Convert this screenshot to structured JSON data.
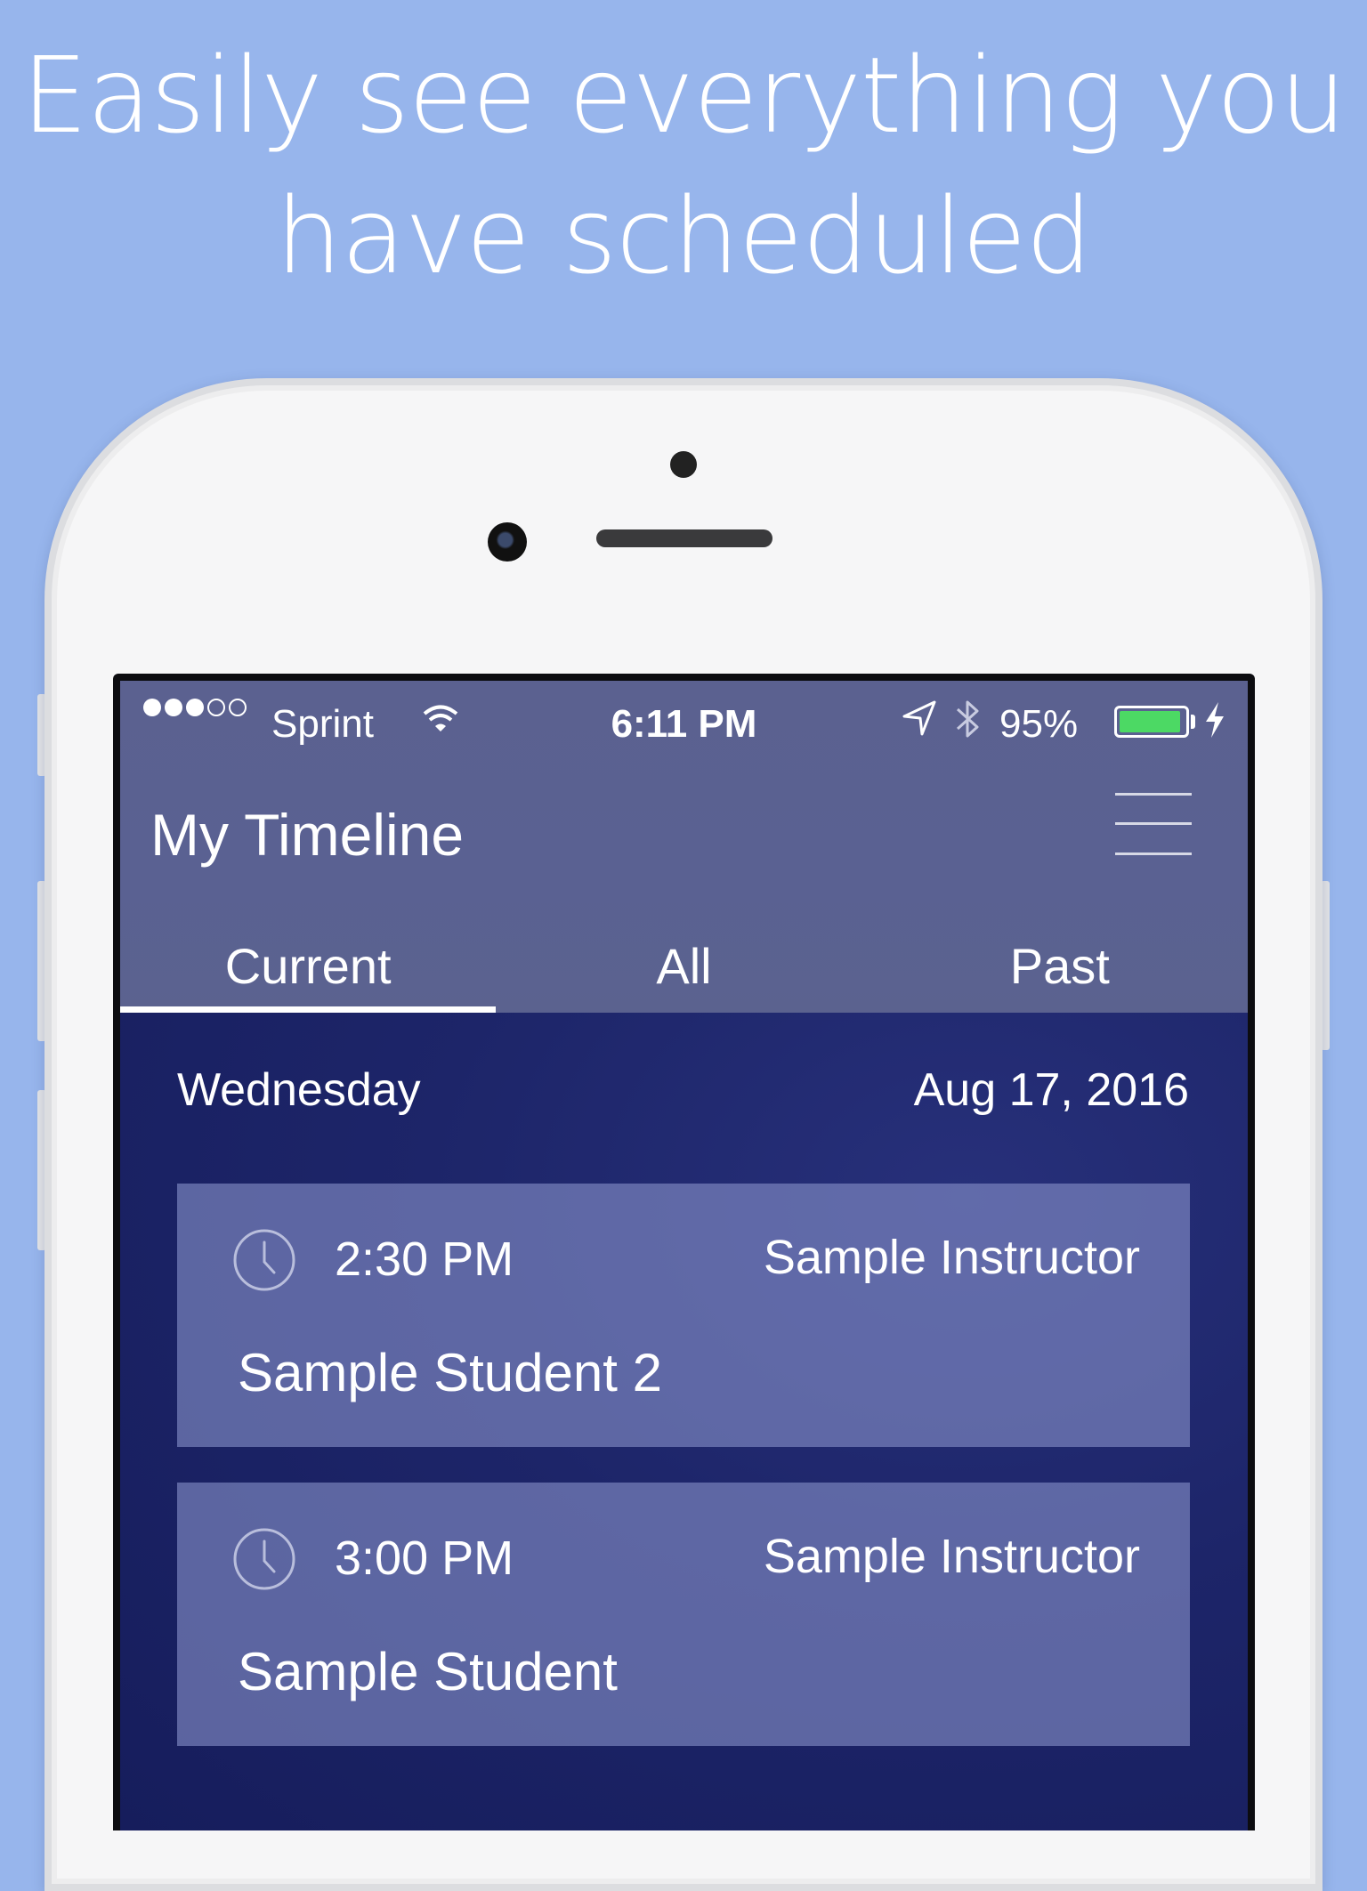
{
  "headline": {
    "line1": "Easily see everything you",
    "line2": "have scheduled"
  },
  "status_bar": {
    "signal_dots": "●●●○○",
    "carrier": "Sprint",
    "time": "6:11 PM",
    "battery_percent": "95%",
    "battery_level": 0.95,
    "battery_color": "#4cd964"
  },
  "app": {
    "title": "My Timeline",
    "menu_icon": "hamburger-menu-icon",
    "tabs": [
      {
        "label": "Current",
        "active": true
      },
      {
        "label": "All",
        "active": false
      },
      {
        "label": "Past",
        "active": false
      }
    ]
  },
  "day": {
    "weekday": "Wednesday",
    "date": "Aug 17, 2016"
  },
  "appointments": [
    {
      "time": "2:30 PM",
      "instructor": "Sample Instructor",
      "student": "Sample Student 2",
      "icon": "clock-icon"
    },
    {
      "time": "3:00 PM",
      "instructor": "Sample Instructor",
      "student": "Sample Student",
      "icon": "clock-icon"
    }
  ],
  "colors": {
    "page_background": "#97b5ec",
    "header_background": "#5b6190",
    "content_background": "#1d2569",
    "card_background": "#8690c8"
  }
}
